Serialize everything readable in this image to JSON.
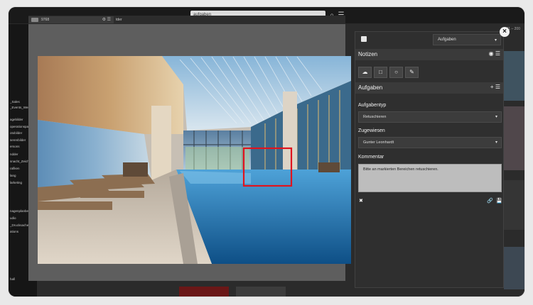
{
  "topbar": {
    "search_value": "aufgaben",
    "search_icon": "search-icon",
    "filter_icon": "filter-icon",
    "right_meta": "101 – 200"
  },
  "sidebar": {
    "items": [
      "_Sales",
      "_Events_Wesse",
      "agebilder",
      "operationspartner",
      "otobilder",
      "serenbilder",
      "ersons",
      "ndder",
      "snacht_Zeichn",
      "rafiken",
      "lang",
      "larketing",
      "nagenplanbeitrat",
      "udio",
      "_Drucksachen",
      "ations",
      "hafi"
    ]
  },
  "viewer": {
    "tab_label": "9768",
    "second_tab_label": "tder",
    "image_alt": "Indoor hotel pool with mosaic wall, loungers, and marked area"
  },
  "panel": {
    "header_select": "Aufgaben",
    "notizen_title": "Notizen",
    "aufgaben_title": "Aufgaben",
    "aufgabentyp_label": "Aufgabentyp",
    "aufgabentyp_value": "Retuschieren",
    "zugewiesen_label": "Zugewiesen",
    "zugewiesen_value": "Gunter Leonhardt",
    "kommentar_label": "Kommentar",
    "kommentar_value": "Bitte an markierten Bereichen retuschieren."
  },
  "colors": {
    "marker": "#e0141e",
    "panel_bg": "#2f2f2f",
    "header_bg": "#3a3a3a"
  }
}
